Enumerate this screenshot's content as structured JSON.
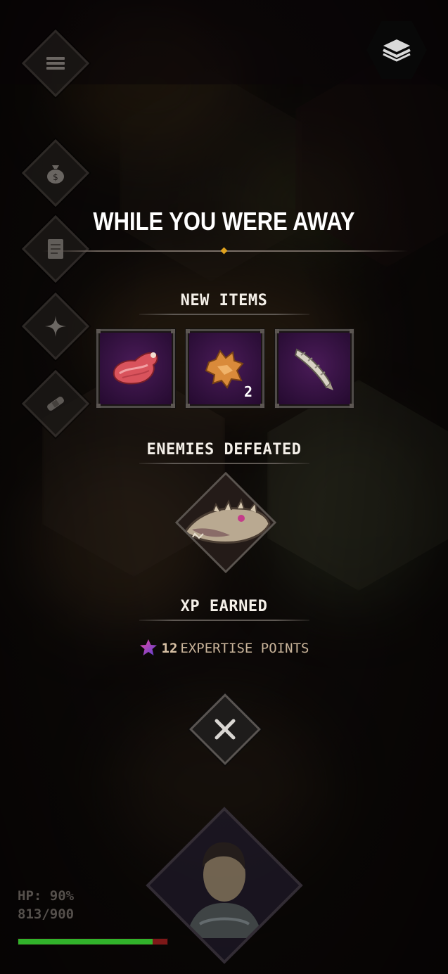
{
  "modal": {
    "title": "WHILE YOU WERE AWAY",
    "new_items_label": "NEW ITEMS",
    "items": [
      {
        "icon": "raw-meat-icon",
        "count": ""
      },
      {
        "icon": "fur-pelt-icon",
        "count": "2"
      },
      {
        "icon": "bone-blade-icon",
        "count": ""
      }
    ],
    "enemies_label": "ENEMIES DEFEATED",
    "enemies": [
      {
        "icon": "spiked-lizard-enemy-icon"
      }
    ],
    "xp_label": "XP EARNED",
    "xp_value": "12",
    "xp_unit": "EXPERTISE POINTS",
    "close_icon": "close-icon"
  },
  "sidebar": {
    "items": [
      {
        "icon": "menu-icon"
      },
      {
        "icon": "money-bag-icon"
      },
      {
        "icon": "scroll-icon"
      },
      {
        "icon": "sparkle-icon"
      },
      {
        "icon": "bandage-icon"
      }
    ]
  },
  "topbar": {
    "layers_icon": "layers-icon"
  },
  "hud": {
    "hp_label": "HP: 90%",
    "hp_values": "813/900",
    "hp_fraction": 0.9
  },
  "colors": {
    "item_slot_bg": "#2e0f3a",
    "hp_fill": "#31b22b",
    "hp_missing": "#7d1818",
    "title_gem": "#e0a21e",
    "xp_star": "#b23fb0"
  }
}
